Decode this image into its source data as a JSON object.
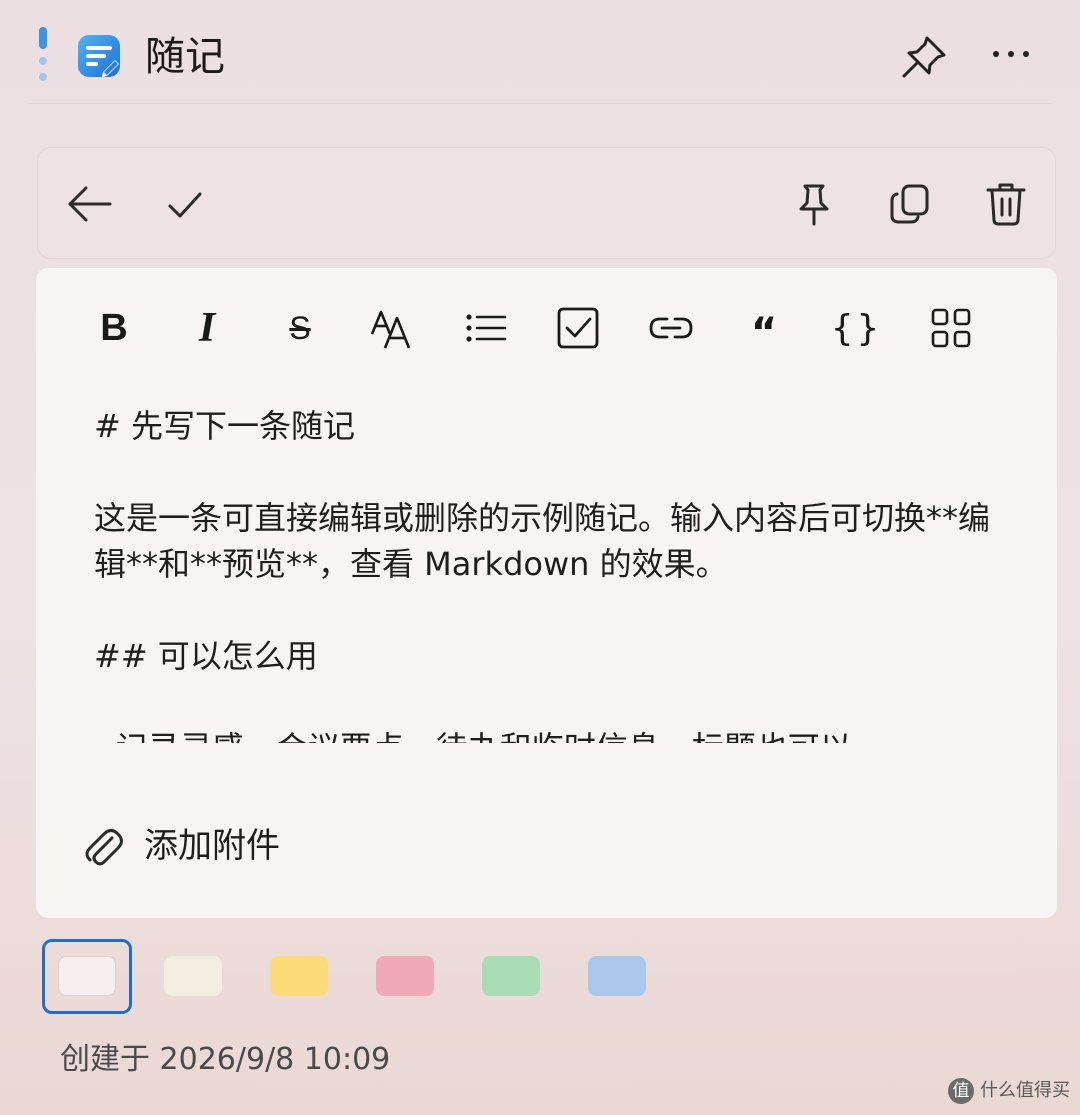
{
  "window": {
    "title": "随记"
  },
  "toolbar": {
    "back": "arrow-left-icon",
    "done": "check-icon",
    "pin": "pin-icon",
    "copy": "copy-icon",
    "delete": "trash-icon"
  },
  "format": {
    "bold": "B",
    "italic": "I",
    "strike": "S",
    "font_size": "AA",
    "bullet_list": "list-icon",
    "checkbox": "checkbox-icon",
    "link": "link-icon",
    "quote": "“",
    "code": "{}",
    "more": "grid-icon"
  },
  "editor": {
    "content": "# 先写下一条随记\n\n这是一条可直接编辑或删除的示例随记。输入内容后可切换**编辑**和**预览**，查看 Markdown 的效果。\n\n## 可以怎么用\n\n- 记录灵感、会议要点、待办和临时信息，标题也可以"
  },
  "attachment": {
    "label": "添加附件"
  },
  "colors": {
    "swatches": [
      "#f4eeee",
      "#f4eee2",
      "#fbdc78",
      "#f1a9b8",
      "#a9dbb5",
      "#a9c8ec"
    ],
    "selected_index": 0,
    "accent": "#1f6fc8"
  },
  "footer": {
    "created": "创建于 2026/9/8 10:09"
  },
  "watermark": {
    "symbol": "值",
    "text": "什么值得买"
  }
}
